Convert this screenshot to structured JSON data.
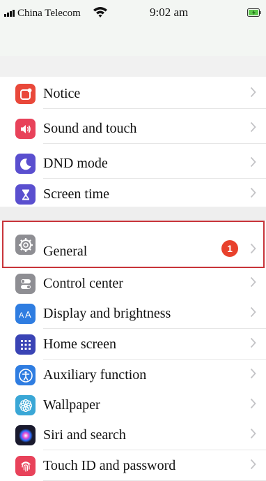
{
  "status_bar": {
    "carrier": "China Telecom",
    "time": "9:02 am"
  },
  "settings": {
    "group1": [
      {
        "label": "Notice",
        "icon": "notice-icon",
        "color": "#e9483a"
      },
      {
        "label": "Sound and touch",
        "icon": "speaker-icon",
        "color": "#e8425a"
      },
      {
        "label": "DND mode",
        "icon": "moon-icon",
        "color": "#5a4fcf"
      },
      {
        "label": "Screen time",
        "icon": "hourglass-icon",
        "color": "#5a4fcf"
      }
    ],
    "general": {
      "label": "General",
      "icon": "gear-icon",
      "color": "#8e8e93",
      "badge": "1"
    },
    "group2": [
      {
        "label": "Control center",
        "icon": "toggles-icon",
        "color": "#8e8e93"
      },
      {
        "label": "Display and brightness",
        "icon": "text-size-icon",
        "color": "#2f7de1"
      },
      {
        "label": "Home screen",
        "icon": "app-grid-icon",
        "color": "#3a44b5"
      },
      {
        "label": "Auxiliary function",
        "icon": "accessibility-icon",
        "color": "#2f7de1"
      },
      {
        "label": "Wallpaper",
        "icon": "flower-icon",
        "color": "#3aa7d6"
      },
      {
        "label": "Siri and search",
        "icon": "siri-icon",
        "color": "#1a1a2e"
      },
      {
        "label": "Touch ID and password",
        "icon": "fingerprint-icon",
        "color": "#e8425a"
      }
    ]
  },
  "colors": {
    "highlight_border": "#c8343a",
    "badge": "#e8412c"
  }
}
